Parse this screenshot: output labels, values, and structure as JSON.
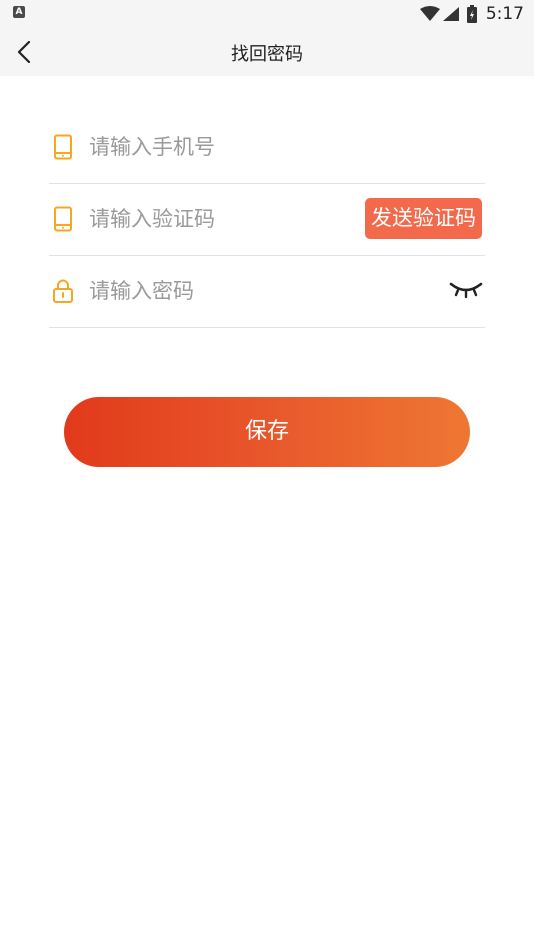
{
  "status_bar": {
    "left_icon_letter": "A",
    "time": "5:17",
    "icons": [
      "wifi-icon",
      "cellular-signal-icon",
      "battery-icon"
    ]
  },
  "header": {
    "back_icon": "chevron-left-icon",
    "title": "找回密码"
  },
  "form": {
    "phone": {
      "icon": "phone-icon",
      "placeholder": "请输入手机号",
      "value": ""
    },
    "code": {
      "icon": "phone-icon",
      "placeholder": "请输入验证码",
      "value": "",
      "send_button_label": "发送验证码"
    },
    "password": {
      "icon": "lock-icon",
      "placeholder": "请输入密码",
      "value": "",
      "toggle_icon": "eye-closed-icon"
    }
  },
  "save_button": {
    "label": "保存"
  },
  "colors": {
    "icon_accent": "#f5a623",
    "send_button": "#f26a4b",
    "save_gradient_start": "#e13a1b",
    "save_gradient_end": "#ee7733"
  }
}
